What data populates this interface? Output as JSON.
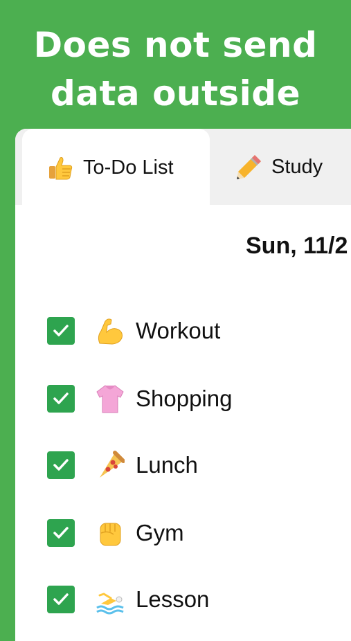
{
  "headline": {
    "line1": "Does not send",
    "line2": "data outside"
  },
  "tabs": [
    {
      "label": "To-Do List",
      "icon": "thumbs-up-icon"
    },
    {
      "label": "Study",
      "icon": "pencil-icon"
    }
  ],
  "date": "Sun, 11/2",
  "todos": [
    {
      "label": "Workout",
      "icon": "flexed-biceps-icon",
      "checked": true
    },
    {
      "label": "Shopping",
      "icon": "blouse-icon",
      "checked": true
    },
    {
      "label": "Lunch",
      "icon": "pizza-icon",
      "checked": true
    },
    {
      "label": "Gym",
      "icon": "raised-fist-icon",
      "checked": true
    },
    {
      "label": "Lesson",
      "icon": "swimmer-icon",
      "checked": true
    }
  ],
  "colors": {
    "background": "#4caf50",
    "checkbox": "#2ea44f",
    "tab_inactive": "#f0f0f0"
  }
}
